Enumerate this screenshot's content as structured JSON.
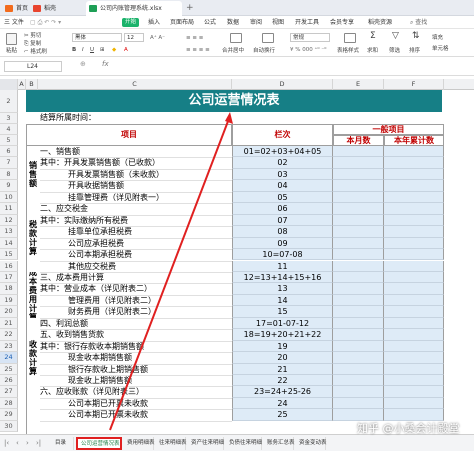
{
  "title_bar": {
    "home_tab": "首页",
    "web_tab": "稻壳",
    "file_tab": "公司内账管理系统.xlsx",
    "add_tab": "+"
  },
  "menu": {
    "items": [
      "三 文件",
      "插入",
      "页面布局",
      "公式",
      "数据",
      "审阅",
      "视图",
      "开发工具",
      "会员专享",
      "稻壳资源"
    ],
    "start": "开始",
    "search_placeholder": "查找"
  },
  "toolbar": {
    "paste": "粘贴",
    "cut": "剪切",
    "copy": "复制",
    "format_painter": "格式刷",
    "font_name": "黑体",
    "font_size": "12",
    "merge": "合并居中",
    "wrap": "自动换行",
    "number_format": "常规",
    "table_style": "表格样式",
    "sum": "求和",
    "filter": "筛选",
    "sort": "排序",
    "fill": "填充",
    "cell_style": "单元格"
  },
  "formula_bar": {
    "name_box": "L24",
    "fx": "fx",
    "formula": ""
  },
  "columns": [
    "A",
    "B",
    "C",
    "D",
    "E",
    "F"
  ],
  "rows": [
    "2",
    "3",
    "4",
    "5",
    "6",
    "7",
    "8",
    "9",
    "10",
    "11",
    "12",
    "13",
    "14",
    "15",
    "16",
    "17",
    "18",
    "19",
    "20",
    "21",
    "22",
    "23",
    "24",
    "25",
    "26",
    "27",
    "28",
    "29",
    "30"
  ],
  "sheet": {
    "title": "公司运营情况表",
    "period_label": "结算所属时间：",
    "header_item": "项目",
    "header_line": "栏次",
    "header_general": "一般项目",
    "header_month": "本月数",
    "header_ytd": "本年累计数",
    "groups": [
      {
        "label": "销\n售\n额"
      },
      {
        "label": "税\n款\n计\n算"
      },
      {
        "label": "成\n本\n费\n用\n计\n算"
      },
      {
        "label": "收\n款\n计\n算"
      }
    ],
    "items": [
      {
        "text": "一、销售额",
        "line": "01=02+03+04+05"
      },
      {
        "text": "其中：开具发票销售额（已收款）",
        "line": "02"
      },
      {
        "text": "开具发票销售额（未收款）",
        "line": "03"
      },
      {
        "text": "开具收据销售额",
        "line": "04"
      },
      {
        "text": "挂靠管理费（详见附表一）",
        "line": "05"
      },
      {
        "text": "二、应交税金",
        "line": "06"
      },
      {
        "text": "其中：实际缴纳所有税费",
        "line": "07"
      },
      {
        "text": "挂靠单位承担税费",
        "line": "08"
      },
      {
        "text": "公司应承担税费",
        "line": "09"
      },
      {
        "text": "公司本期承担税费",
        "line": "10=07-08"
      },
      {
        "text": "其他应交税费",
        "line": "11"
      },
      {
        "text": "三、成本费用计算",
        "line": "12=13+14+15+16"
      },
      {
        "text": "其中：营业成本（详见附表二）",
        "line": "13"
      },
      {
        "text": "管理费用（详见附表二）",
        "line": "14"
      },
      {
        "text": "财务费用（详见附表二）",
        "line": "15"
      },
      {
        "text": "四、利润总额",
        "line": "17=01-07-12"
      },
      {
        "text": "五、收到销售货款",
        "line": "18=19+20+21+22"
      },
      {
        "text": "其中：银行存款收本期销售额",
        "line": "19"
      },
      {
        "text": "现金收本期销售额",
        "line": "20"
      },
      {
        "text": "银行存款收上期销售额",
        "line": "21"
      },
      {
        "text": "现金收上期销售额",
        "line": "22"
      },
      {
        "text": "六、应收账款（详见附表三）",
        "line": "23=24+25-26"
      },
      {
        "text": "公司本期已开票未收款",
        "line": "24"
      },
      {
        "text": "公司本期已开票未收款",
        "line": "25"
      }
    ]
  },
  "sheet_tabs": [
    "目录",
    "公司运营情况表",
    "费用明细表",
    "往来明细表",
    "资产往来明细",
    "负债往来明细",
    "账务汇总表",
    "资金变动表"
  ],
  "active_sheet": "公司运营情况表",
  "watermark": "知乎 @小桑会计殿堂",
  "colors": {
    "title_bg": "#167f86",
    "header_text": "#c00000",
    "cell_blue": "#deebf7",
    "annotation_red": "#e02020"
  }
}
